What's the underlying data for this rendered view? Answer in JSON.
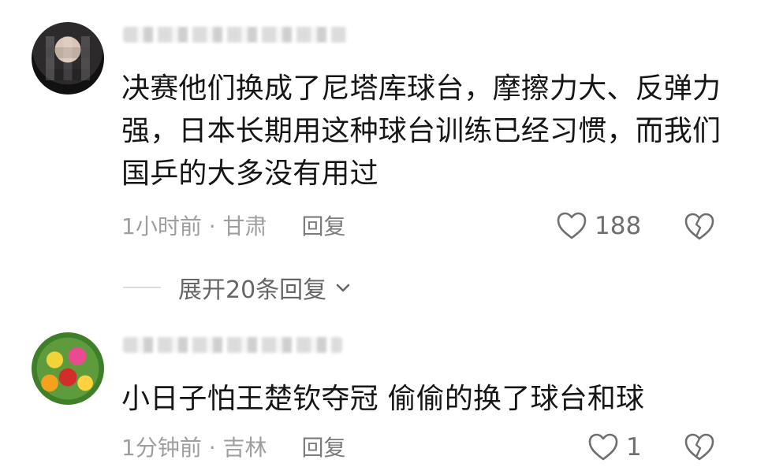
{
  "comments": [
    {
      "text": "决赛他们换成了尼塔库球台，摩擦力大、反弹力强，日本长期用这种球台训练已经习惯，而我们国乒的大多没有用过",
      "time_location": "1小时前 · 甘肃",
      "reply_label": "回复",
      "likes": "188",
      "icons": {
        "like": "heart-icon",
        "dislike": "broken-heart-icon"
      }
    },
    {
      "text": "小日子怕王楚钦夺冠 偷偷的换了球台和球",
      "time_location": "1分钟前 · 吉林",
      "reply_label": "回复",
      "likes": "1",
      "icons": {
        "like": "heart-icon",
        "dislike": "broken-heart-icon"
      }
    }
  ],
  "expand_replies_label": "展开20条回复",
  "colors": {
    "text_primary": "#161616",
    "text_secondary": "#9e9e9e",
    "icon_gray": "#6f6f6f",
    "divider": "#dddddd"
  }
}
